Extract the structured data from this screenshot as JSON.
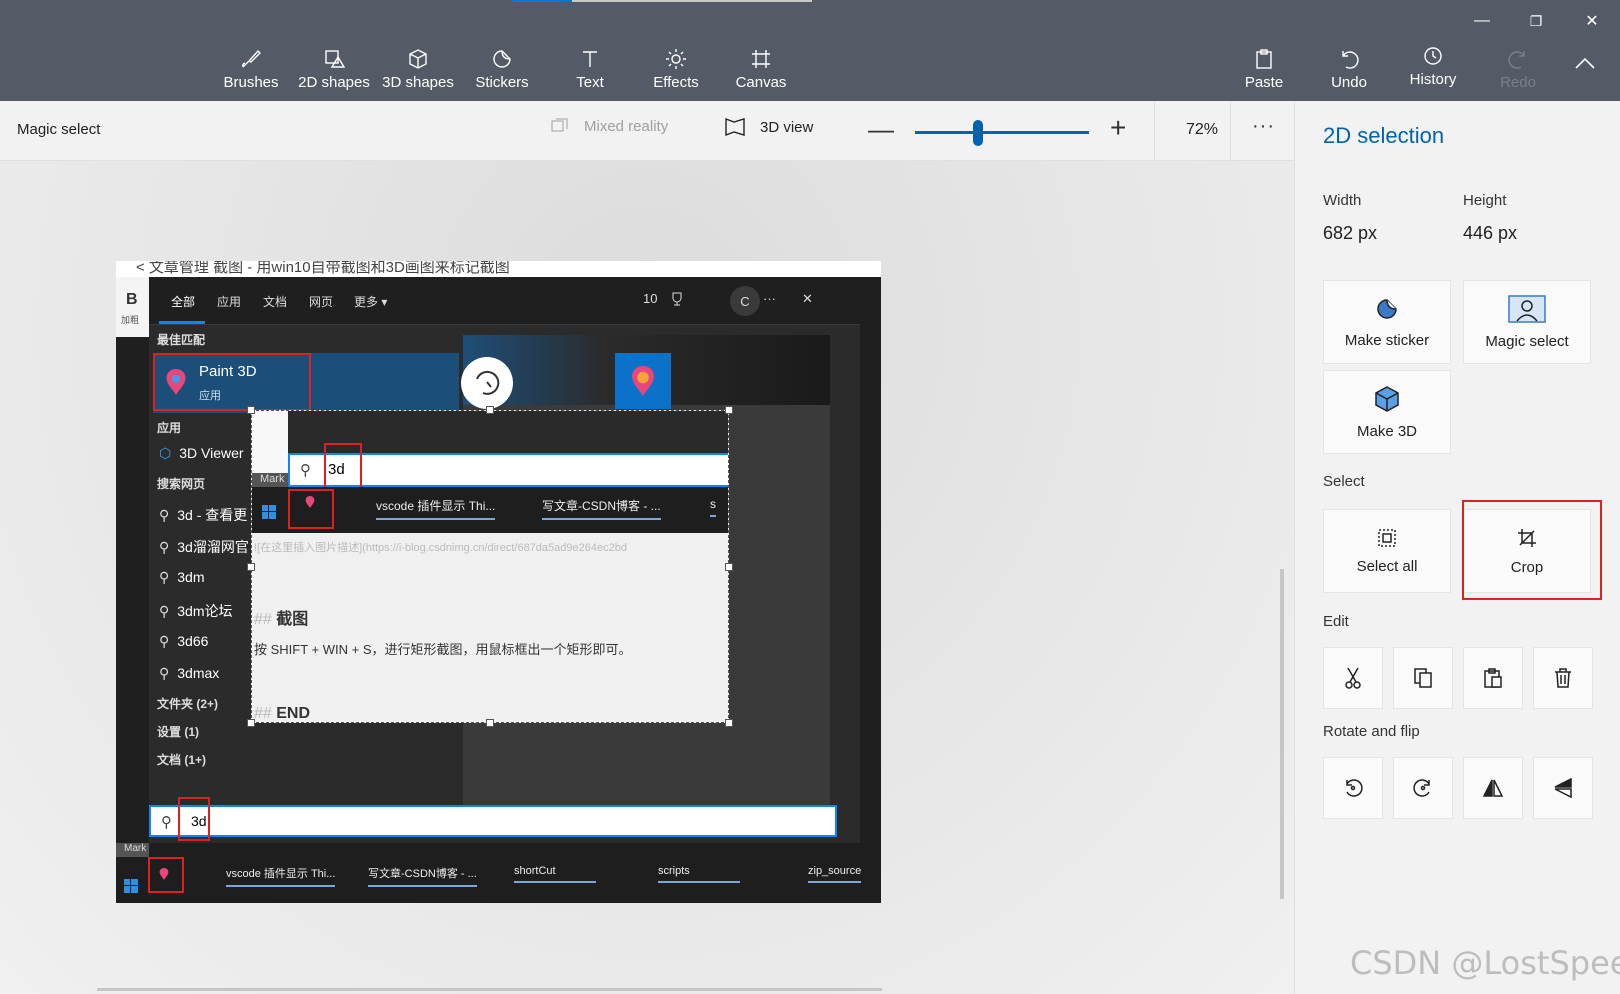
{
  "window": {
    "minimize": "—",
    "restore": "❐",
    "close": "✕"
  },
  "toolbar": {
    "tools": [
      {
        "name": "brushes",
        "label": "Brushes"
      },
      {
        "name": "2d-shapes",
        "label": "2D shapes"
      },
      {
        "name": "3d-shapes",
        "label": "3D shapes"
      },
      {
        "name": "stickers",
        "label": "Stickers"
      },
      {
        "name": "text",
        "label": "Text"
      },
      {
        "name": "effects",
        "label": "Effects"
      },
      {
        "name": "canvas",
        "label": "Canvas"
      }
    ],
    "paste_label": "Paste",
    "undo_label": "Undo",
    "history_label": "History",
    "redo_label": "Redo"
  },
  "subbar": {
    "mode": "Magic select",
    "mixed_reality": "Mixed reality",
    "view_3d": "3D view",
    "zoom_out": "—",
    "zoom_in": "+",
    "zoom_value": "72%",
    "zoom_level_percent": 36,
    "more": "···"
  },
  "picture": {
    "top_strip": "< 文章管理   截图 - 用win10自带截图和3D画图来标记截图",
    "bold_b": "B",
    "bold_label": "加粗",
    "tabs": [
      "全部",
      "应用",
      "文档",
      "网页",
      "更多 ▾"
    ],
    "count": "10",
    "c_label": "C",
    "more_dots": "···",
    "close": "✕",
    "best_match_heading": "最佳匹配",
    "best_match_name": "Paint 3D",
    "best_match_sub": "应用",
    "apps_heading": "应用",
    "app_item": "3D Viewer",
    "web_heading": "搜索网页",
    "web_items": [
      "3d - 查看更",
      "3d溜溜网官",
      "3dm",
      "3dm论坛",
      "3d66",
      "3dmax"
    ],
    "folders": "文件夹 (2+)",
    "settings": "设置 (1)",
    "docs": "文档 (1+)",
    "search_query": "3d",
    "taskbar_mark": "Mark",
    "taskbar_items": [
      "vscode 插件显示 Thi...",
      "写文章-CSDN博客 - ...",
      "shortCut",
      "scripts",
      "zip_source"
    ],
    "overlay": {
      "search_query": "3d",
      "mark": "Mark",
      "taskbar_items": [
        "vscode 插件显示 Thi...",
        "写文章-CSDN博客 - ...",
        "s"
      ],
      "note": "![在这里插入图片描述](https://i-blog.csdnimg.cn/direct/687da5ad9e264ec2bd",
      "heading_hash": "##",
      "heading": "截图",
      "body": "按 SHIFT + WIN + S，进行矩形截图，用鼠标框出一个矩形即可。",
      "end_hash": "##",
      "end": "END"
    }
  },
  "panel": {
    "title": "2D selection",
    "width_label": "Width",
    "width_value": "682 px",
    "height_label": "Height",
    "height_value": "446 px",
    "make_sticker": "Make sticker",
    "magic_select": "Magic select",
    "make_3d": "Make 3D",
    "select_heading": "Select",
    "select_all": "Select all",
    "crop": "Crop",
    "edit_heading": "Edit",
    "rotate_heading": "Rotate and flip"
  },
  "watermark": "CSDN @LostSpeed",
  "colors": {
    "accent": "#0063b1",
    "toolbar": "#545b66",
    "highlight": "#e02020"
  }
}
